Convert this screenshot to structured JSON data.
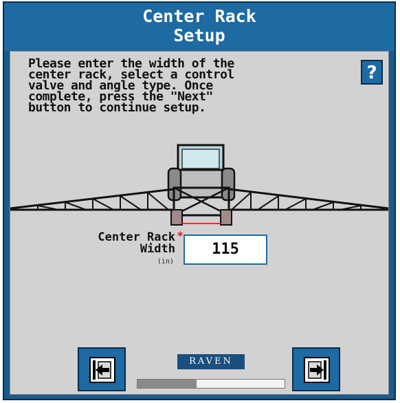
{
  "title": {
    "line1": "Center Rack",
    "line2": "Setup"
  },
  "instructions": "Please enter the width of the\ncenter rack, select a control\nvalve and angle type. Once\ncomplete, press the \"Next\"\nbutton to continue setup.",
  "help_button": {
    "label": "?"
  },
  "center_rack_width": {
    "label_line1": "Center Rack",
    "label_line2": "Width",
    "required_marker": "*",
    "unit": "(in)",
    "value": "115"
  },
  "logo": {
    "text": "RAVEN"
  },
  "progress": {
    "fraction": 0.4
  },
  "colors": {
    "title_bar": "#1e6aa3",
    "panel": "#d2d2d2",
    "button": "#1e6aa3",
    "required": "#e01010"
  },
  "icons": {
    "back": "back-arrow-icon",
    "next": "next-arrow-icon",
    "help": "question-icon"
  }
}
